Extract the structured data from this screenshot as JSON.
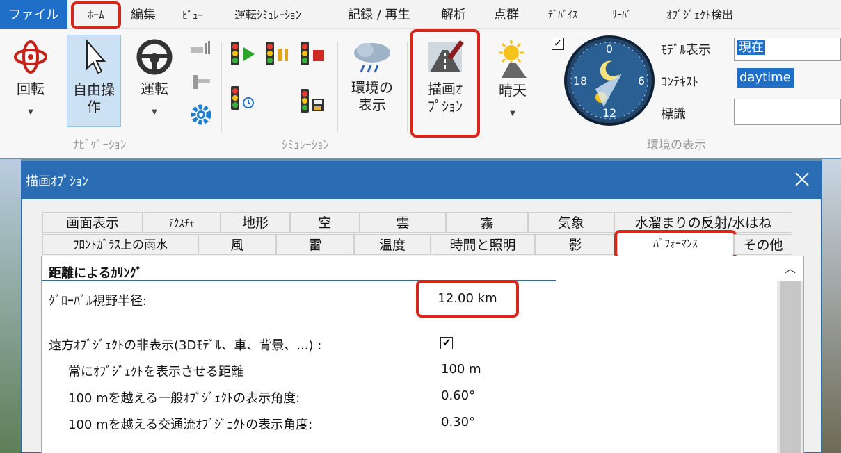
{
  "menu": {
    "file": "ファイル",
    "home": "ﾎｰﾑ",
    "edit": "編集",
    "view": "ﾋﾞｭｰ",
    "drive_sim": "運転ｼﾐｭﾚｰｼｮﾝ",
    "record": "記録 / 再生",
    "analysis": "解析",
    "pointcloud": "点群",
    "device": "ﾃﾞﾊﾞｲｽ",
    "server": "ｻｰﾊﾞ",
    "object_detect": "ｵﾌﾞｼﾞｪｸﾄ検出"
  },
  "ribbon": {
    "rotate": "回転",
    "free_op_1": "自由操",
    "free_op_2": "作",
    "drive": "運転",
    "env_display_1": "環境の",
    "env_display_2": "表示",
    "render_opt_1": "描画ｵ",
    "render_opt_2": "ﾌﾟｼｮﾝ",
    "sunny": "晴天",
    "groups": {
      "navigation": "ﾅﾋﾞｹﾞｰｼｮﾝ",
      "simulation": "ｼﾐｭﾚｰｼｮﾝ",
      "environment": "環境の表示"
    },
    "clock": {
      "n0": "0",
      "n6": "6",
      "n12": "12",
      "n18": "18"
    },
    "env_panel": {
      "model_label": "ﾓﾃﾞﾙ表示",
      "model_value": "現在",
      "context_label": "ｺﾝﾃｷｽﾄ",
      "context_value": "daytime",
      "sign_label": "標識",
      "sign_value": ""
    }
  },
  "dialog": {
    "title": "描画ｵﾌﾟｼｮﾝ",
    "tabs_row1": [
      "画面表示",
      "ﾃｸｽﾁｬ",
      "地形",
      "空",
      "雲",
      "霧",
      "気象",
      "水溜まりの反射/水はね"
    ],
    "tabs_row2": [
      "ﾌﾛﾝﾄｶﾞﾗｽ上の雨水",
      "風",
      "雷",
      "温度",
      "時間と照明",
      "影",
      "ﾊﾟﾌｫｰﾏﾝｽ",
      "その他"
    ],
    "section_title": "距離によるｶﾘﾝｸﾞ",
    "rows": [
      {
        "label": "ｸﾞﾛｰﾊﾞﾙ視野半径:",
        "value": "12.00 km"
      },
      {
        "label": "遠方ｵﾌﾞｼﾞｪｸﾄの非表示(3Dﾓﾃﾞﾙ、車、背景、...) :",
        "value": "✔"
      },
      {
        "label": "常にｵﾌﾞｼﾞｪｸﾄを表示させる距離",
        "value": "100 m"
      },
      {
        "label": "100 mを越える一般ｵﾌﾞｼﾞｪｸﾄの表示角度:",
        "value": "0.60°"
      },
      {
        "label": "100 mを越える交通流ｵﾌﾞｼﾞｪｸﾄの表示角度:",
        "value": "0.30°"
      }
    ]
  },
  "colors": {
    "accent": "#2b6db5",
    "highlight": "#d8261b",
    "file_bg": "#1f6fc9"
  }
}
